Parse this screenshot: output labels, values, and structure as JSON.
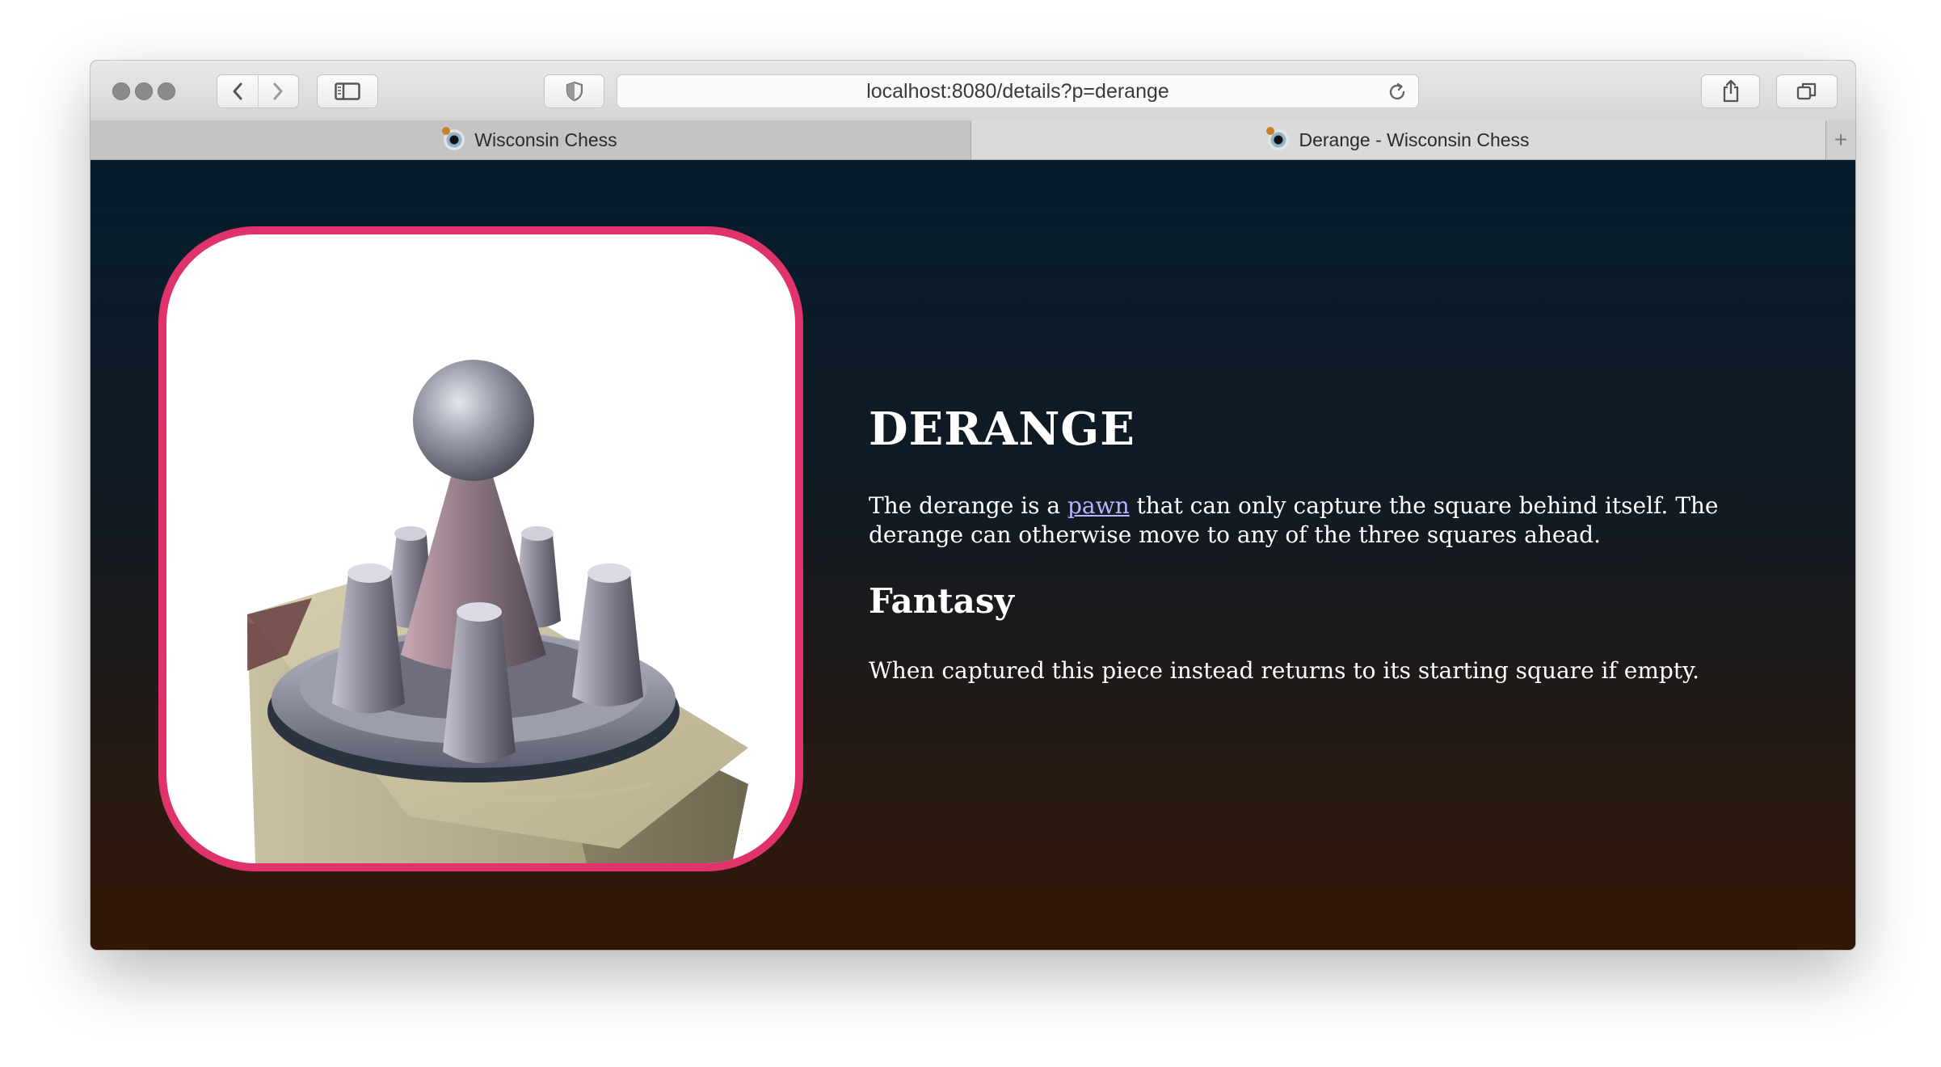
{
  "browser": {
    "url": "localhost:8080/details?p=derange",
    "tabs": [
      {
        "label": "Wisconsin Chess",
        "active": false
      },
      {
        "label": "Derange - Wisconsin Chess",
        "active": true
      }
    ],
    "new_tab_label": "+"
  },
  "piece": {
    "title": "DERANGE",
    "description_before": "The derange is a ",
    "description_link": "pawn",
    "description_after": " that can only capture the square behind itself. The derange can otherwise move to any of the three squares ahead.",
    "fantasy_heading": "Fantasy",
    "fantasy_text": "When captured this piece instead returns to its starting square if empty.",
    "image_icon": "derange-piece-render",
    "frame_color": "#e0336b",
    "link_color": "#b9b3ff"
  }
}
